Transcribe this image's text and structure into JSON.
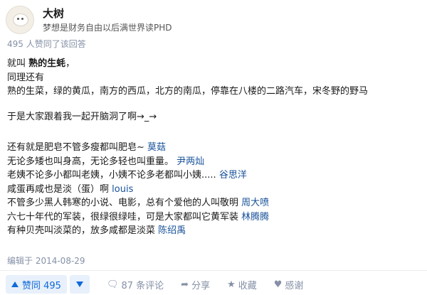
{
  "author": {
    "name": "大树",
    "bio": "梦想是财务自由以后满世界读PHD"
  },
  "upvote_note": "495 人赞同了该回答",
  "content": {
    "line1_prefix": "就叫",
    "line1_bold": "熟的生蚝",
    "line1_suffix": "，",
    "line2": "同理还有",
    "line3": "熟的生菜，绿的黄瓜，南方的西瓜，北方的南瓜，停靠在八楼的二路汽车，宋冬野的野马",
    "line4": "于是大家跟着我一起开脑洞了啊→_→",
    "quotes": [
      {
        "text": "还有就是肥皂不管多瘦都叫肥皂~",
        "author": "莫菇"
      },
      {
        "text": "无论多矮也叫身高，无论多轻也叫重量。",
        "author": "尹两灿"
      },
      {
        "text": "老姨不论多小都叫老姨，小姨不论多老都叫小姨.....",
        "author": "谷思洋"
      },
      {
        "text": "咸蛋再咸也是淡（蛋）啊",
        "author": "louis"
      },
      {
        "text": "不管多少黑人韩寒的小说、电影，总有个爱他的人叫敬明",
        "author": "周大喷"
      },
      {
        "text": "六七十年代的军装，很绿很绿哇，可是大家都叫它黄军装",
        "author": "林腾腾"
      },
      {
        "text": "有种贝壳叫淡菜的，放多咸都是淡菜",
        "author": "陈绍禹"
      }
    ]
  },
  "edited": "编辑于 2014-08-29",
  "actions": {
    "upvote_label": "赞同 495",
    "comments": "87 条评论",
    "share": "分享",
    "favorite": "收藏",
    "thanks": "感谢"
  },
  "icons": {
    "comment": "comment-bubble-icon",
    "share": "share-arrow-icon",
    "favorite": "star-icon",
    "thanks": "heart-icon"
  },
  "colors": {
    "accent": "#0f6ad8",
    "author_link": "#175199",
    "muted": "#8590a6"
  }
}
